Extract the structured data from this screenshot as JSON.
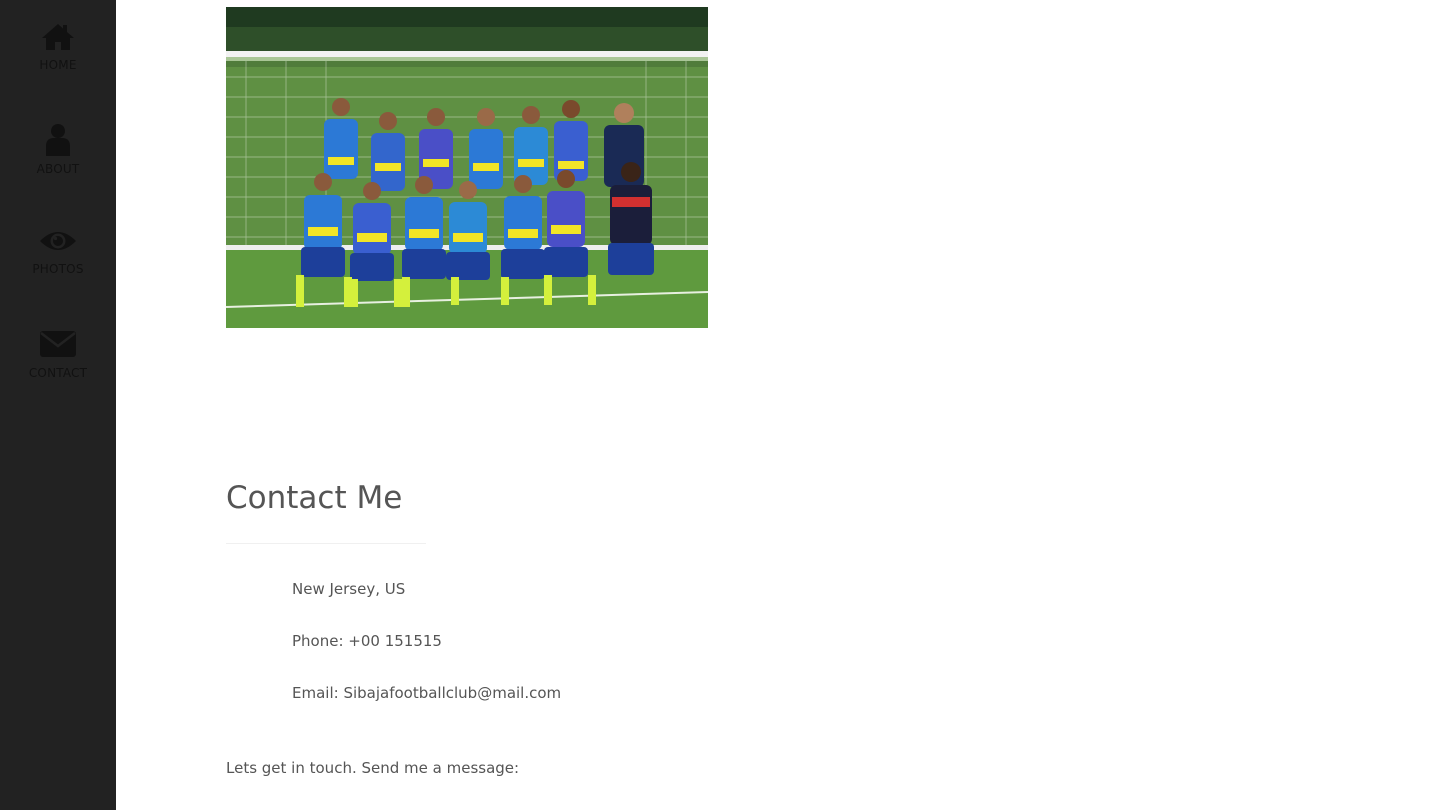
{
  "nav": {
    "items": [
      {
        "label": "HOME",
        "icon": "home-icon"
      },
      {
        "label": "ABOUT",
        "icon": "user-icon"
      },
      {
        "label": "PHOTOS",
        "icon": "eye-icon"
      },
      {
        "label": "CONTACT",
        "icon": "envelope-icon"
      }
    ]
  },
  "photo": {
    "alt": "Team photo of youth football players in blue and yellow jerseys in front of a goal net"
  },
  "contact": {
    "title": "Contact Me",
    "location": "New Jersey, US",
    "phone": "Phone: +00 151515",
    "email": "Email: Sibajafootballclub@mail.com",
    "cta": "Lets get in touch. Send me a message:"
  },
  "colors": {
    "sidebar_bg": "#222222",
    "icon_color": "#111111",
    "text": "#555555"
  }
}
